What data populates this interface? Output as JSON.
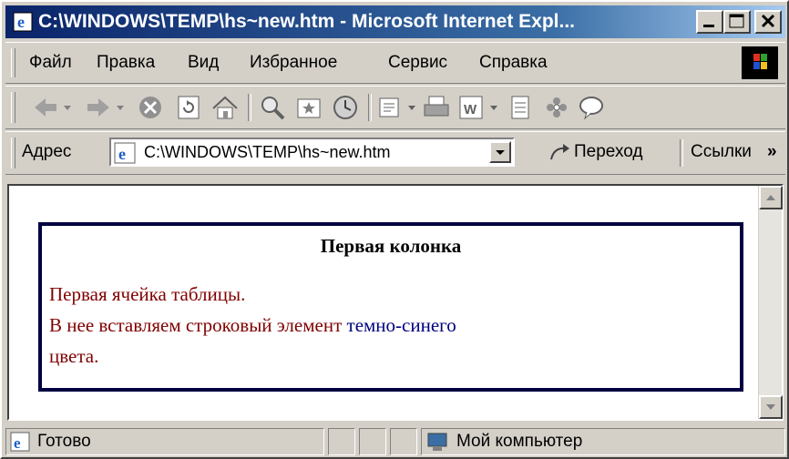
{
  "window": {
    "title": "C:\\WINDOWS\\TEMP\\hs~new.htm - Microsoft Internet Expl..."
  },
  "menu": {
    "items": [
      {
        "label": "Файл"
      },
      {
        "label": "Правка"
      },
      {
        "label": "Вид"
      },
      {
        "label": "Избранное"
      },
      {
        "label": "Сервис"
      },
      {
        "label": "Справка"
      }
    ]
  },
  "toolbar": {
    "buttons": [
      "back-icon",
      "forward-icon",
      "stop-icon",
      "refresh-icon",
      "home-icon",
      "search-icon",
      "favorites-icon",
      "history-icon",
      "mail-icon",
      "print-icon",
      "word-icon",
      "notepad-icon",
      "messenger-icon",
      "discuss-icon"
    ]
  },
  "address": {
    "label": "Адрес",
    "url": "C:\\WINDOWS\\TEMP\\hs~new.htm",
    "go_label": "Переход",
    "links_label": "Ссылки",
    "more": "»"
  },
  "content": {
    "header": "Первая колонка",
    "cell_line1": "Первая ячейка таблицы.",
    "cell_line2_red": "В нее вставляем строковый элемент ",
    "cell_line2_navy": "темно-синего",
    "cell_line3": "цвета.",
    "colors": {
      "cell_text": "#800000",
      "span_text": "#000080",
      "border": "#000040"
    }
  },
  "status": {
    "left": "Готово",
    "zone": "Мой компьютер"
  }
}
